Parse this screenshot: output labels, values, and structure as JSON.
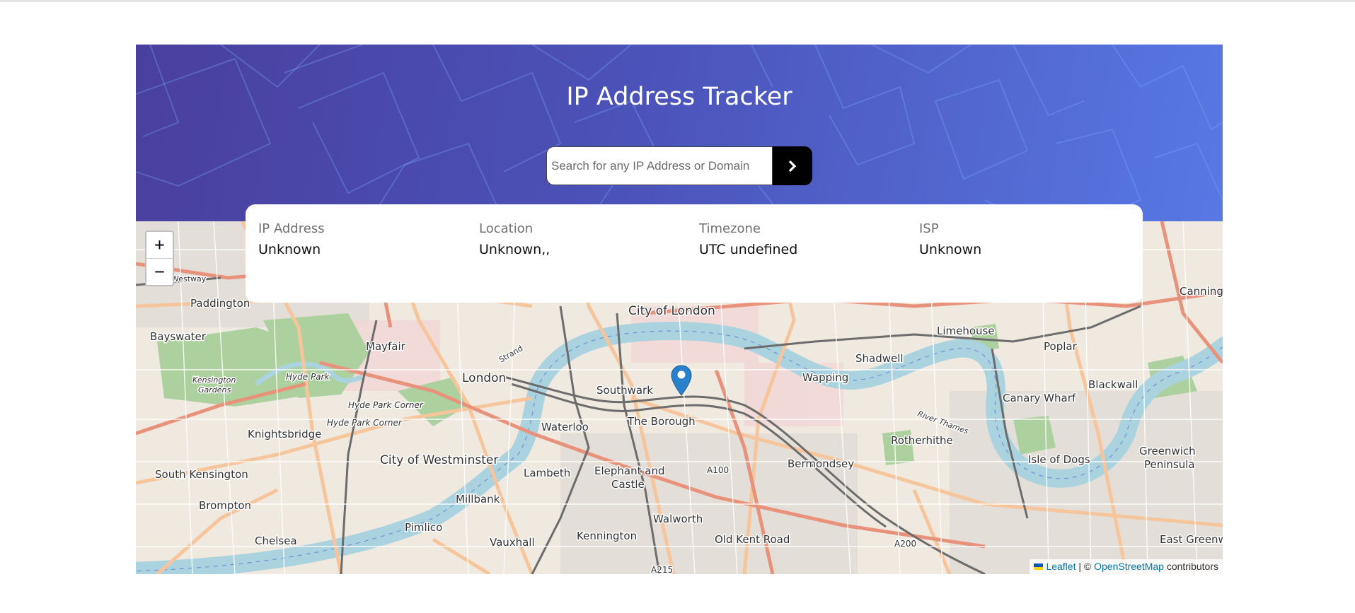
{
  "app": {
    "title": "IP Address Tracker"
  },
  "search": {
    "placeholder": "Search for any IP Address or Domain",
    "value": ""
  },
  "info": {
    "ip": {
      "label": "IP Address",
      "value": "Unknown"
    },
    "location": {
      "label": "Location",
      "value": "Unknown,,"
    },
    "timezone": {
      "label": "Timezone",
      "value": "UTC undefined"
    },
    "isp": {
      "label": "ISP",
      "value": "Unknown"
    }
  },
  "map": {
    "zoom_in": "+",
    "zoom_out": "−",
    "attribution": {
      "leaflet": "Leaflet",
      "separator": " | © ",
      "osm": "OpenStreetMap",
      "suffix": " contributors"
    },
    "labels": {
      "paddington": "Paddington",
      "bayswater": "Bayswater",
      "mayfair": "Mayfair",
      "london": "London",
      "kensington_gardens_1": "Kensington",
      "kensington_gardens_2": "Gardens",
      "hyde_park": "Hyde Park",
      "hyde_park_corner_1": "Hyde Park Corner",
      "hyde_park_corner_2": "Hyde Park Corner",
      "knightsbridge": "Knightsbridge",
      "south_kensington": "South Kensington",
      "brompton": "Brompton",
      "chelsea": "Chelsea",
      "city_of_westminster": "City of Westminster",
      "pimlico": "Pimlico",
      "millbank": "Millbank",
      "lambeth": "Lambeth",
      "waterloo": "Waterloo",
      "vauxhall": "Vauxhall",
      "kennington": "Kennington",
      "elephant_1": "Elephant and",
      "elephant_2": "Castle",
      "southwark": "Southwark",
      "the_borough": "The Borough",
      "city_of_london": "City of London",
      "walworth": "Walworth",
      "old_kent_road": "Old Kent Road",
      "a100": "A100",
      "a200": "A200",
      "a215": "A215",
      "bermondsey": "Bermondsey",
      "wapping": "Wapping",
      "shadwell": "Shadwell",
      "limehouse": "Limehouse",
      "rotherhithe": "Rotherhithe",
      "poplar": "Poplar",
      "blackwall": "Blackwall",
      "canary_wharf": "Canary Wharf",
      "isle_of_dogs": "Isle of Dogs",
      "greenwich_1": "Greenwich",
      "greenwich_2": "Peninsula",
      "east_greenwich": "East Greenwi",
      "canning": "Canning",
      "strand": "Strand",
      "westway": "Westway",
      "river_thames": "River Thames"
    }
  },
  "colors": {
    "header_start": "#4a3f9e",
    "header_end": "#5878e3",
    "button": "#000000",
    "marker": "#2a81cb",
    "river": "#aad3df"
  },
  "icons": {
    "submit": "chevron-right-icon",
    "marker": "map-marker-icon",
    "flag": "ukraine-flag-icon"
  }
}
